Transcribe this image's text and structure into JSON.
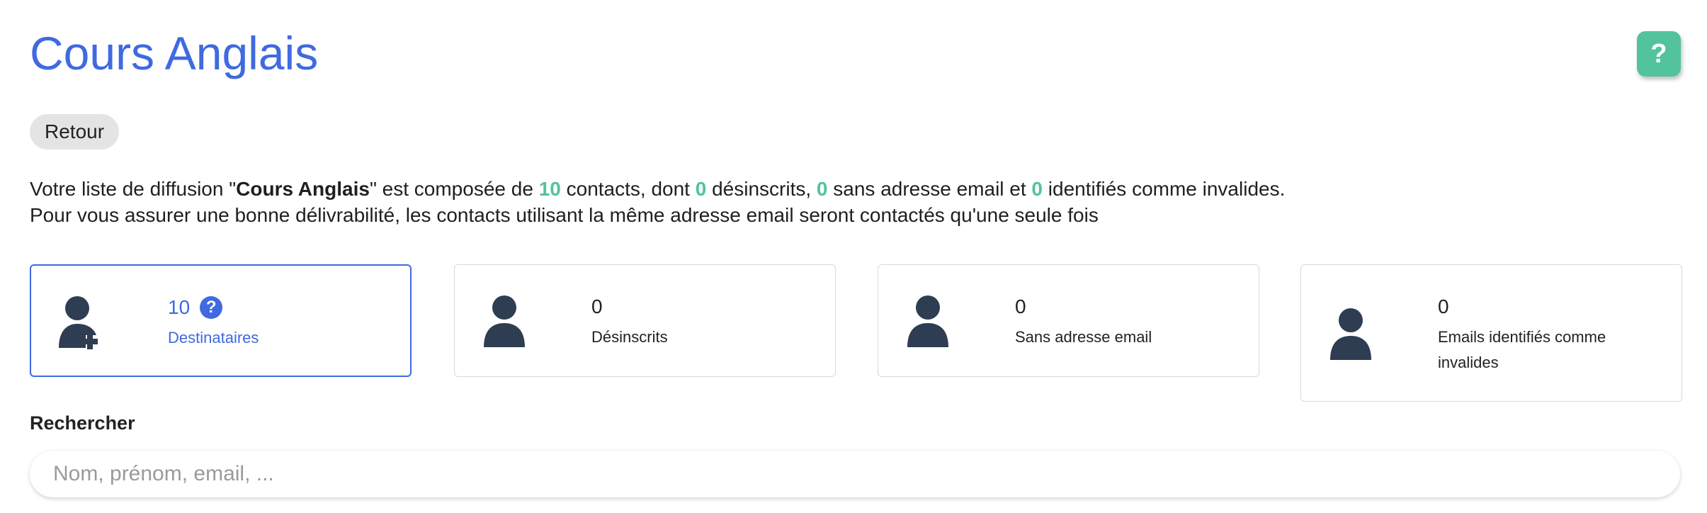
{
  "page": {
    "title": "Cours Anglais",
    "help_label": "?",
    "back_label": "Retour"
  },
  "summary": {
    "line1_prefix": "Votre liste de diffusion \"",
    "list_name": "Cours Anglais",
    "line1_after_name": "\" est composée de ",
    "contacts_count": "10",
    "after_contacts": " contacts, dont ",
    "unsubscribed_count": "0",
    "after_unsubscribed": " désinscrits, ",
    "no_email_count": "0",
    "after_no_email": " sans adresse email et ",
    "invalid_count": "0",
    "after_invalid": " identifiés comme invalides.",
    "line2": "Pour vous assurer une bonne délivrabilité, les contacts utilisant la même adresse email seront contactés qu'une seule fois"
  },
  "stats": [
    {
      "count": "10",
      "label": "Destinataires",
      "icon": "user-add-icon",
      "active": true,
      "has_info": true,
      "info_label": "?"
    },
    {
      "count": "0",
      "label": "Désinscrits",
      "icon": "user-icon",
      "active": false
    },
    {
      "count": "0",
      "label": "Sans adresse email",
      "icon": "user-icon",
      "active": false
    },
    {
      "count": "0",
      "label": "Emails identifiés comme invalides",
      "icon": "user-icon",
      "active": false
    }
  ],
  "search": {
    "label": "Rechercher",
    "placeholder": "Nom, prénom, email, ...",
    "value": ""
  },
  "colors": {
    "accent": "#3f6ae0",
    "success": "#52c39c",
    "icon": "#2e3d52"
  }
}
